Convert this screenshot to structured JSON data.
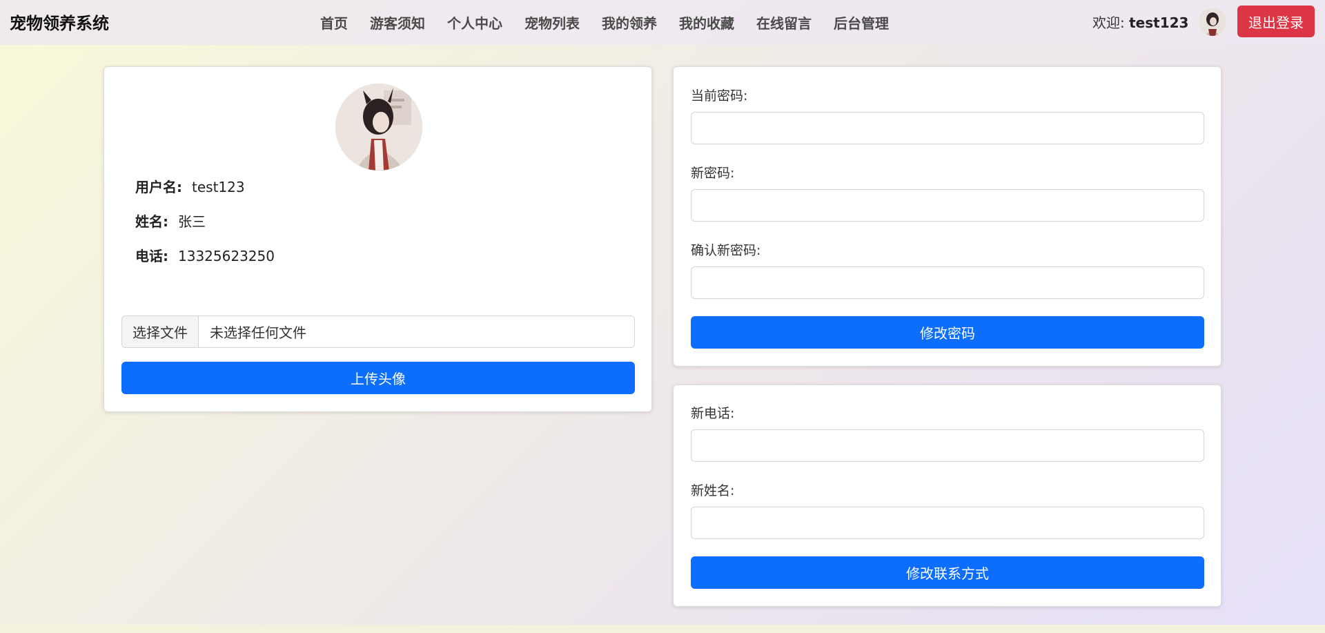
{
  "header": {
    "brand": "宠物领养系统",
    "nav": [
      "首页",
      "游客须知",
      "个人中心",
      "宠物列表",
      "我的领养",
      "我的收藏",
      "在线留言",
      "后台管理"
    ],
    "welcome_prefix": "欢迎:",
    "username": "test123",
    "logout_label": "退出登录"
  },
  "profile": {
    "username_label": "用户名:",
    "username_value": "test123",
    "name_label": "姓名:",
    "name_value": "张三",
    "phone_label": "电话:",
    "phone_value": "13325623250",
    "file_button_label": "选择文件",
    "file_status": "未选择任何文件",
    "upload_label": "上传头像"
  },
  "password_form": {
    "current_label": "当前密码:",
    "new_label": "新密码:",
    "confirm_label": "确认新密码:",
    "submit_label": "修改密码"
  },
  "contact_form": {
    "phone_label": "新电话:",
    "name_label": "新姓名:",
    "submit_label": "修改联系方式"
  },
  "colors": {
    "primary": "#0d6efd",
    "danger": "#dc3545"
  }
}
